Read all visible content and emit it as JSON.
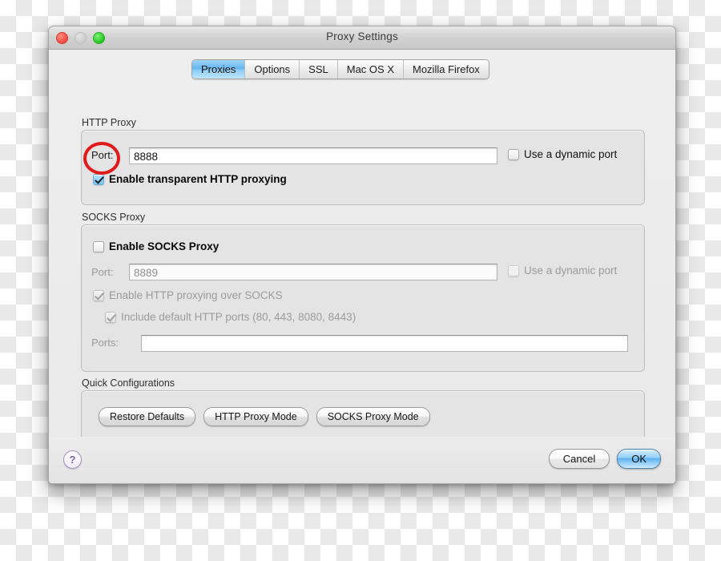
{
  "window": {
    "title": "Proxy Settings",
    "traffic_lights": [
      "close-button",
      "minimize-button",
      "zoom-button"
    ]
  },
  "tabs": [
    {
      "label": "Proxies",
      "active": true
    },
    {
      "label": "Options",
      "active": false
    },
    {
      "label": "SSL",
      "active": false
    },
    {
      "label": "Mac OS X",
      "active": false
    },
    {
      "label": "Mozilla Firefox",
      "active": false
    }
  ],
  "http_proxy": {
    "group_label": "HTTP Proxy",
    "port_label": "Port:",
    "port_value": "8888",
    "dynamic_port_label": "Use a dynamic port",
    "dynamic_port_checked": false,
    "transparent_label": "Enable transparent HTTP proxying",
    "transparent_checked": true
  },
  "socks_proxy": {
    "group_label": "SOCKS Proxy",
    "enable_label": "Enable SOCKS Proxy",
    "enable_checked": false,
    "port_label": "Port:",
    "port_value": "8889",
    "dynamic_port_label": "Use a dynamic port",
    "dynamic_port_checked": false,
    "http_over_socks_label": "Enable HTTP proxying over SOCKS",
    "http_over_socks_checked": true,
    "default_ports_label": "Include default HTTP ports (80, 443, 8080, 8443)",
    "default_ports_checked": true,
    "ports_label": "Ports:",
    "ports_value": "",
    "ports_placeholder": ""
  },
  "quick_configurations": {
    "group_label": "Quick Configurations",
    "buttons": [
      {
        "label": "Restore Defaults"
      },
      {
        "label": "HTTP Proxy Mode"
      },
      {
        "label": "SOCKS Proxy Mode"
      }
    ]
  },
  "footer": {
    "help_label": "?",
    "cancel_label": "Cancel",
    "ok_label": "OK"
  },
  "annotation": {
    "shape": "ellipse",
    "color": "#e01b1b",
    "target": "transparent-http-proxying-checkbox"
  }
}
